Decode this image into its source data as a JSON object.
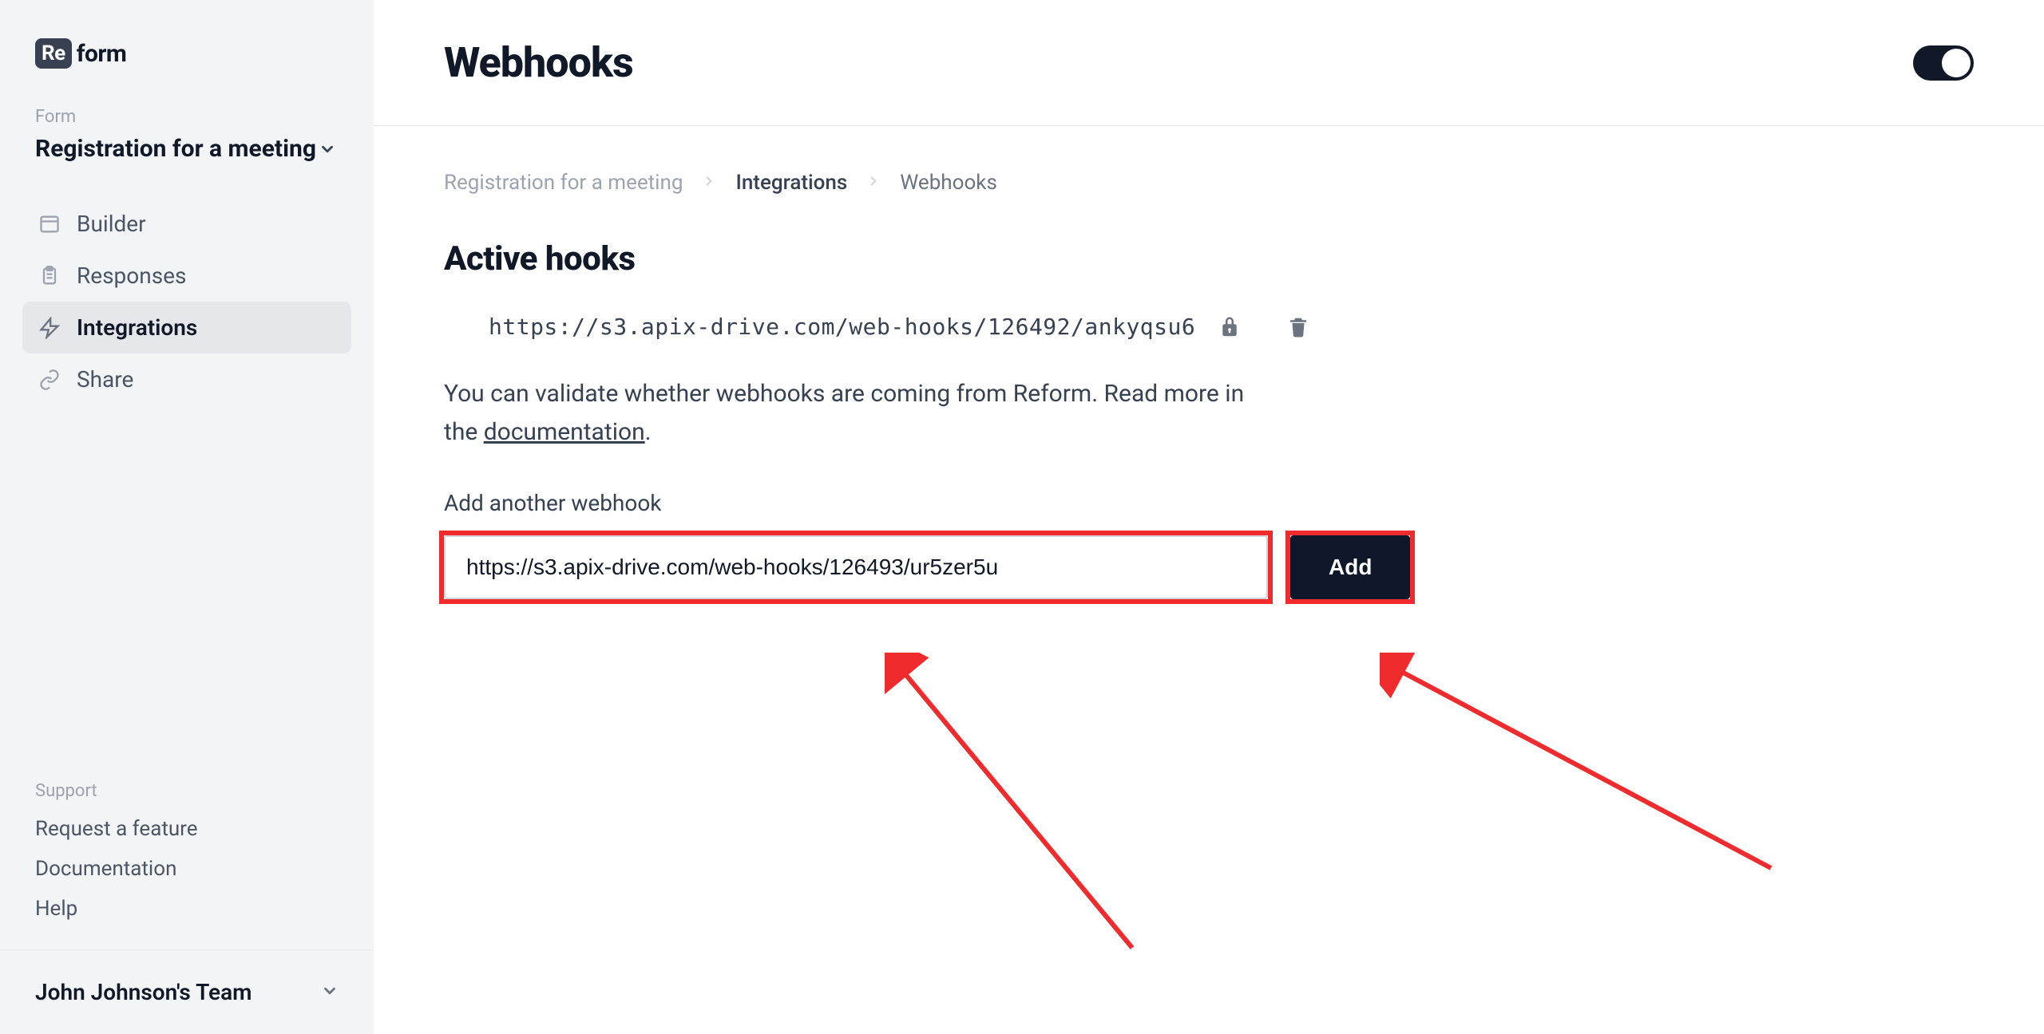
{
  "logo": {
    "badge": "Re",
    "text": "form"
  },
  "sidebar": {
    "form_label": "Form",
    "form_name": "Registration for a meeting",
    "items": [
      {
        "label": "Builder"
      },
      {
        "label": "Responses"
      },
      {
        "label": "Integrations"
      },
      {
        "label": "Share"
      }
    ],
    "support_label": "Support",
    "support_links": [
      {
        "label": "Request a feature"
      },
      {
        "label": "Documentation"
      },
      {
        "label": "Help"
      }
    ],
    "team_name": "John Johnson's Team"
  },
  "header": {
    "title": "Webhooks"
  },
  "breadcrumb": {
    "root": "Registration for a meeting",
    "mid": "Integrations",
    "current": "Webhooks"
  },
  "active_hooks": {
    "title": "Active hooks",
    "hooks": [
      {
        "url": "https://s3.apix-drive.com/web-hooks/126492/ankyqsu6"
      }
    ],
    "validate_prefix": "You can validate whether webhooks are coming from Reform. Read more in the ",
    "validate_link": "documentation",
    "validate_suffix": "."
  },
  "add": {
    "label": "Add another webhook",
    "value": "https://s3.apix-drive.com/web-hooks/126493/ur5zer5u",
    "button": "Add"
  }
}
